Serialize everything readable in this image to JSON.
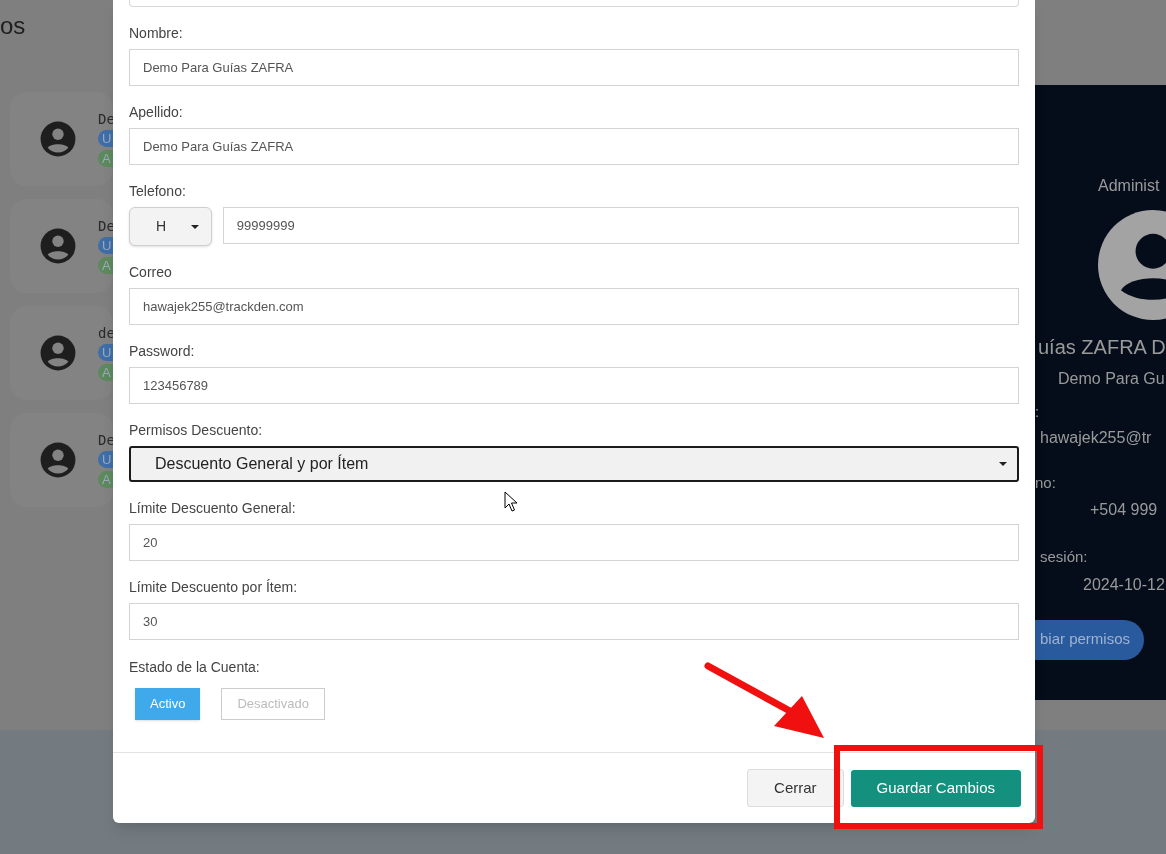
{
  "page": {
    "title": "os",
    "users": [
      {
        "name": "De",
        "badges": [
          {
            "text": "U",
            "color": "#3f6ea8"
          },
          {
            "text": "A",
            "color": "#5d8a5d"
          }
        ]
      },
      {
        "name": "De",
        "badges": [
          {
            "text": "U",
            "color": "#3f6ea8"
          },
          {
            "text": "A",
            "color": "#5d8a5d"
          }
        ]
      },
      {
        "name": "de",
        "badges": [
          {
            "text": "U",
            "color": "#3f6ea8"
          },
          {
            "text": "A",
            "color": "#5d8a5d"
          }
        ]
      },
      {
        "name": "De",
        "badges": [
          {
            "text": "U",
            "color": "#3f6ea8"
          },
          {
            "text": "A",
            "color": "#5d8a5d"
          }
        ]
      }
    ]
  },
  "profile_panel": {
    "role": "Administ",
    "name": "uías ZAFRA D",
    "subtitle": "Demo Para Gu",
    "email_label": ":",
    "email": "hawajek255@tr",
    "phone_label": "no:",
    "phone": "+504 999",
    "session_label": "sesión:",
    "session": "2024-10-12",
    "button": "biar permisos"
  },
  "modal": {
    "fields": [
      {
        "kind": "text",
        "label": "Nombre:",
        "value": "Demo Para Guías ZAFRA"
      },
      {
        "kind": "text",
        "label": "Apellido:",
        "value": "Demo Para Guías ZAFRA"
      },
      {
        "kind": "phone",
        "label": "Telefono:",
        "prefix": "H",
        "value": "99999999"
      },
      {
        "kind": "text",
        "label": "Correo",
        "value": "hawajek255@trackden.com"
      },
      {
        "kind": "text",
        "label": "Password:",
        "value": "123456789"
      },
      {
        "kind": "select",
        "label": "Permisos Descuento:",
        "value": "Descuento General y por Ítem"
      },
      {
        "kind": "text",
        "label": "Límite Descuento General:",
        "value": "20"
      },
      {
        "kind": "text",
        "label": "Límite Descuento por Ítem:",
        "value": "30"
      }
    ],
    "status": {
      "label": "Estado de la Cuenta:",
      "options": [
        {
          "label": "Activo",
          "selected": true
        },
        {
          "label": "Desactivado",
          "selected": false
        }
      ]
    },
    "buttons": [
      {
        "kind": "secondary",
        "label": "Cerrar"
      },
      {
        "kind": "primary",
        "label": "Guardar Cambios"
      }
    ]
  }
}
